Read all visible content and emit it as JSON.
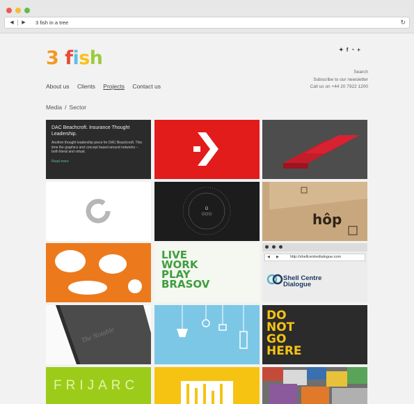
{
  "browser": {
    "url": "3 fish in a tree",
    "back_icon": "back-arrow-icon",
    "forward_icon": "forward-arrow-icon",
    "reload_icon": "reload-icon"
  },
  "logo": {
    "digit": "3",
    "f": "f",
    "i": "i",
    "s": "s",
    "h": "h"
  },
  "social": [
    "twitter-icon",
    "facebook-icon",
    "rss-icon",
    "plus-icon"
  ],
  "utility": {
    "search": "Search",
    "newsletter": "Subscribe to our newsletter",
    "phone": "Call us on +44 20 7922 1200"
  },
  "nav": {
    "about": "About us",
    "clients": "Clients",
    "projects": "Projects",
    "contact": "Contact us"
  },
  "breadcrumb": {
    "first": "Media",
    "separator": "/",
    "second": "Sector"
  },
  "tiles": {
    "dac": {
      "title": "DAC Beachcroft. Insurance Thought Leadership.",
      "description": "Another thought leadership piece for DAC Beachcroft. This time the graphics and concept based around networks – both literal and virtual.",
      "more": "Read more"
    },
    "hop": "hôp",
    "live": [
      "LIVE",
      "WORK",
      "PLAY",
      "BRASOV"
    ],
    "shell_url": "http://shellcentredialogue.com",
    "shell_logo": [
      "Shell Centre",
      "Dialogue"
    ],
    "book": "The Notable",
    "donot": [
      "DO",
      "NOT",
      "GO",
      "HERE"
    ],
    "frij": "FRIJARC"
  },
  "colors": {
    "accent_orange": "#f29a24",
    "accent_red": "#e84a36",
    "accent_blue": "#5dbfe8",
    "accent_yellow": "#fbc01a",
    "accent_green": "#9ccb3b"
  }
}
